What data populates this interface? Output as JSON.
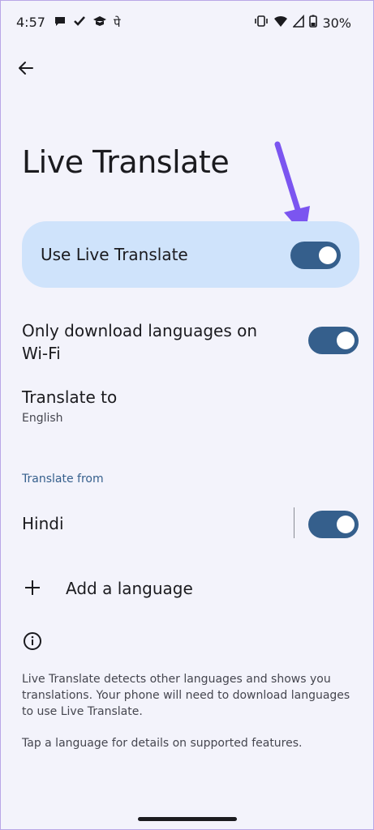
{
  "status_bar": {
    "time": "4:57",
    "battery": "30%",
    "notif_glyph": "पे"
  },
  "header": {
    "title": "Live Translate"
  },
  "main_toggle": {
    "label": "Use Live Translate",
    "on": true
  },
  "wifi_setting": {
    "label": "Only download languages on Wi-Fi",
    "on": true
  },
  "translate_to": {
    "label": "Translate to",
    "value": "English"
  },
  "translate_from": {
    "section_header": "Translate from",
    "languages": [
      {
        "label": "Hindi",
        "on": true
      }
    ]
  },
  "add_language": {
    "label": "Add a language"
  },
  "info": {
    "text": "Live Translate detects other languages and shows you translations. Your phone will need to download languages to use Live Translate.",
    "text2": "Tap a language for details on supported features."
  },
  "colors": {
    "accent": "#355f8c",
    "highlight_row": "#cfe3fb",
    "annotation_arrow": "#7b55f0",
    "background": "#f3f3fb"
  }
}
